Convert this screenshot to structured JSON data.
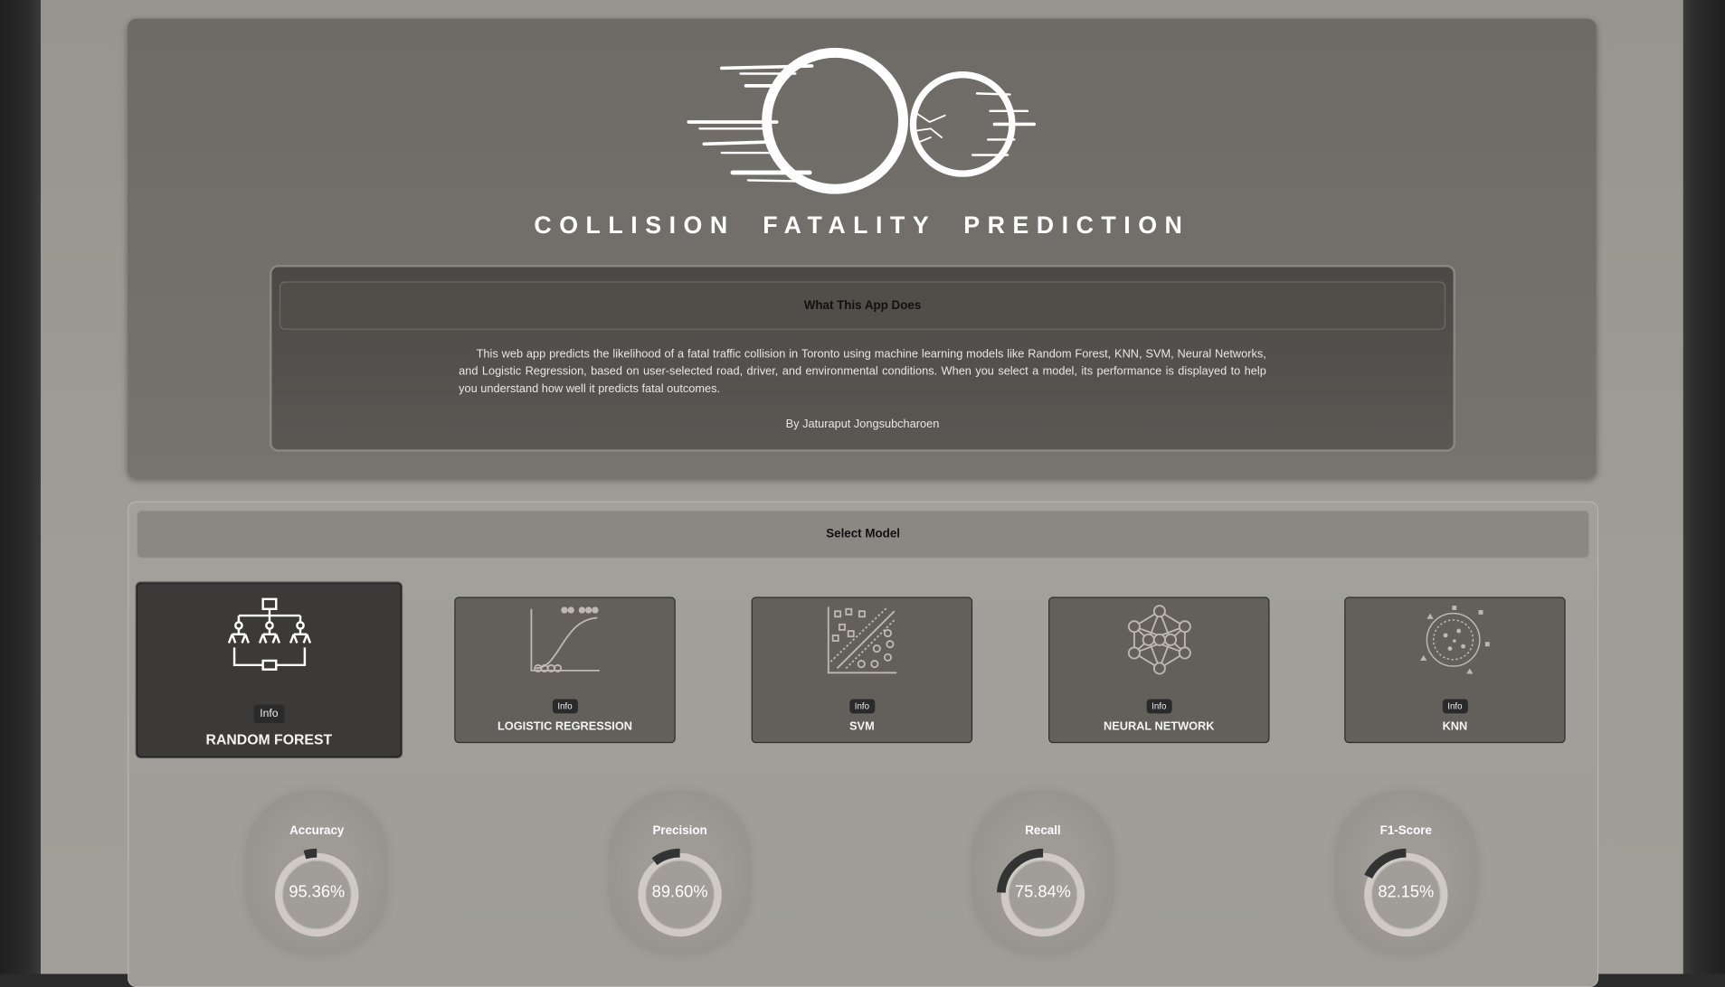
{
  "header": {
    "title": "COLLISION FATALITY PREDICTION"
  },
  "about": {
    "heading": "What This App Does",
    "description": "This web app predicts the likelihood of a fatal traffic collision in Toronto using machine learning models like Random Forest, KNN, SVM, Neural Networks, and Logistic Regression, based on user-selected road, driver, and environmental conditions. When you select a model, its performance is displayed to help you understand how well it predicts fatal outcomes.",
    "author": "By Jaturaput Jongsubcharoen"
  },
  "model_select": {
    "heading": "Select Model",
    "selected": "RANDOM FOREST",
    "models": [
      {
        "name": "RANDOM FOREST",
        "info": "Info",
        "icon": "decision-tree-icon"
      },
      {
        "name": "LOGISTIC REGRESSION",
        "info": "Info",
        "icon": "sigmoid-curve-icon"
      },
      {
        "name": "SVM",
        "info": "Info",
        "icon": "svm-scatter-icon"
      },
      {
        "name": "NEURAL NETWORK",
        "info": "Info",
        "icon": "neural-network-icon"
      },
      {
        "name": "KNN",
        "info": "Info",
        "icon": "knn-cluster-icon"
      }
    ]
  },
  "metrics": [
    {
      "label": "Accuracy",
      "value": "95.36%",
      "fraction": 0.9536
    },
    {
      "label": "Precision",
      "value": "89.60%",
      "fraction": 0.896
    },
    {
      "label": "Recall",
      "value": "75.84%",
      "fraction": 0.7584
    },
    {
      "label": "F1-Score",
      "value": "82.15%",
      "fraction": 0.8215
    }
  ],
  "colors": {
    "hero_panel": "#75716c",
    "active_card": "#3b3a38",
    "card": "#63605b",
    "gauge_fill": "#d6d1cd",
    "gauge_remainder": "#333333"
  }
}
